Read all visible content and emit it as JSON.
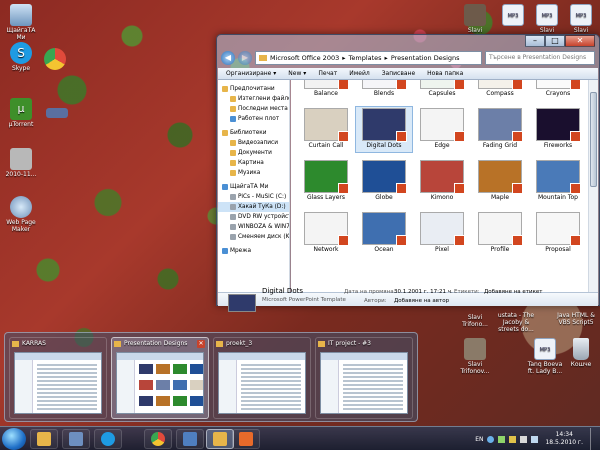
{
  "desktop": {
    "icons_left": [
      {
        "label": "ЩайгаТА Ми"
      },
      {
        "label": "Skype"
      },
      {
        "label": ""
      },
      {
        "label": "µTorrent"
      },
      {
        "label": ""
      },
      {
        "label": "2010-11..."
      },
      {
        "label": "Web Page Maker"
      }
    ],
    "icons_top_right": [
      {
        "label": "Slavi"
      },
      {
        "label": ""
      },
      {
        "label": "Slavi"
      },
      {
        "label": "Slavi"
      }
    ],
    "icons_bottom_right": [
      {
        "label": "Slavi Trifonov..."
      },
      {
        "label": "Tanq Boeva ft. Lady B..."
      },
      {
        "label": "Кошче"
      }
    ]
  },
  "explorer": {
    "breadcrumb": [
      "Microsoft Office 2003",
      "Templates",
      "Presentation Designs"
    ],
    "search_placeholder": "Търсене в Presentation Designs",
    "commands": [
      "Организиране ▾",
      "New ▾",
      "Печат",
      "Имейл",
      "Записване",
      "Нова папка"
    ],
    "nav": [
      {
        "label": "Предпочитани",
        "head": true,
        "icon": "star"
      },
      {
        "label": "Изтеглени файлове",
        "icon": "folder"
      },
      {
        "label": "Последни места",
        "icon": "folder"
      },
      {
        "label": "Работен плот",
        "icon": "blue"
      },
      {
        "gap": true
      },
      {
        "label": "Библиотеки",
        "head": true,
        "icon": "folder"
      },
      {
        "label": "Видеозаписи",
        "icon": "folder"
      },
      {
        "label": "Документи",
        "icon": "folder"
      },
      {
        "label": "Картина",
        "icon": "folder"
      },
      {
        "label": "Музика",
        "icon": "folder"
      },
      {
        "gap": true
      },
      {
        "label": "ЩайгаТА Ми",
        "head": true,
        "icon": "blue"
      },
      {
        "label": "PiCs - MuSiC (C:)",
        "icon": "grey"
      },
      {
        "label": "Хакай ТуКа (D:)",
        "icon": "grey",
        "sel": true
      },
      {
        "label": "DVD RW устройст...",
        "icon": "grey"
      },
      {
        "label": "WINBOZA & WIN7 (...",
        "icon": "grey"
      },
      {
        "label": "Сменяем диск (K:)",
        "icon": "grey"
      },
      {
        "gap": true
      },
      {
        "label": "Мрежа",
        "head": true,
        "icon": "blue"
      }
    ],
    "thumbnails": [
      {
        "label": "Balance",
        "color": "#f2f2f2"
      },
      {
        "label": "Blends",
        "color": "#f5f5f8"
      },
      {
        "label": "Capsules",
        "color": "#eef4ee"
      },
      {
        "label": "Compass",
        "color": "#f4f1ea"
      },
      {
        "label": "Crayons",
        "color": "#fbfbfb"
      },
      {
        "label": "Curtain Call",
        "color": "#d9d0c0"
      },
      {
        "label": "Digital Dots",
        "color": "#2f3a6b"
      },
      {
        "label": "Edge",
        "color": "#f4f4f4"
      },
      {
        "label": "Fading Grid",
        "color": "#6c7fa8"
      },
      {
        "label": "Fireworks",
        "color": "#1a0f2e"
      },
      {
        "label": "Glass Layers",
        "color": "#2d8a2d"
      },
      {
        "label": "Globe",
        "color": "#1f4f96"
      },
      {
        "label": "Kimono",
        "color": "#b8453a"
      },
      {
        "label": "Maple",
        "color": "#b87227"
      },
      {
        "label": "Mountain Top",
        "color": "#4a7ab8"
      },
      {
        "label": "Network",
        "color": "#f4f4f4"
      },
      {
        "label": "Ocean",
        "color": "#3f6fb0"
      },
      {
        "label": "Pixel",
        "color": "#e9edf3"
      },
      {
        "label": "Profile",
        "color": "#f5f5f5"
      },
      {
        "label": "Proposal",
        "color": "#f7f7f7"
      }
    ],
    "details": {
      "name": "Digital Dots",
      "type": "Microsoft PowerPoint Template",
      "modified_label": "Дата на промяна:",
      "modified_value": "30.1.2001 г. 17:21 ч.",
      "author_label": "Автори:",
      "author_value": "Добавяне на автор",
      "tags_label": "Етикети:",
      "tags_value": "Добавяне на етикет"
    }
  },
  "thumbs_strip": [
    {
      "title": "KARRAS"
    },
    {
      "title": "Presentation Designs"
    },
    {
      "title": "proekt_3"
    },
    {
      "title": "IT project - #3"
    }
  ],
  "desktop_bg_text": [
    "Slavi Trifono...",
    "ustata - The Jacoby & streets do...",
    "Java HTML & VBS Script5"
  ],
  "tray": {
    "lang": "EN",
    "time": "14:34",
    "date": "18.5.2010 г."
  }
}
